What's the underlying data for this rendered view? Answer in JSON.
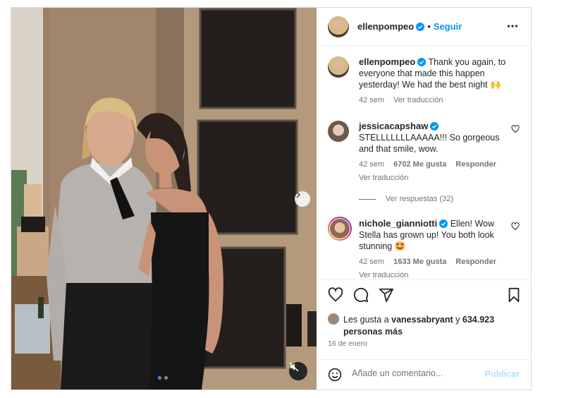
{
  "post": {
    "author": "ellenpompeo",
    "follow_label": "Seguir",
    "caption": "Thank you again, to everyone that made this happen yesterday! We had the best night 🙌",
    "caption_age": "42 sem",
    "see_translation": "Ver traducción"
  },
  "comments": [
    {
      "user": "jessicacapshaw",
      "text": "STELLLLLLLAAAAA!!! So gorgeous and that smile, wow.",
      "age": "42 sem",
      "likes": "6702 Me gusta",
      "reply": "Responder",
      "translate": "Ver traducción",
      "view_replies": "Ver respuestas (32)"
    },
    {
      "user": "nichole_gianniotti",
      "text": "Ellen! Wow Stella has grown up! You both look stunning 🤩",
      "age": "42 sem",
      "likes": "1633 Me gusta",
      "reply": "Responder",
      "translate": "Ver traducción"
    }
  ],
  "likes_line": {
    "prefix": "Les gusta a",
    "user": "vanessabryant",
    "joiner": "y",
    "count": "634.923",
    "suffix": "personas más"
  },
  "date": "16 de enero",
  "add_comment": {
    "placeholder": "Añade un comentario...",
    "publish_label": "Publicar"
  },
  "colors": {
    "accent": "#0095f6",
    "verified": "#0095f6",
    "muted": "#737373",
    "publish_disabled": "#b2dffc"
  },
  "icons": [
    "heart-icon",
    "comment-icon",
    "share-icon",
    "bookmark-icon",
    "more-icon",
    "verified-icon",
    "emoji-icon",
    "mute-icon",
    "chevron-right-icon"
  ],
  "carousel": {
    "total_slides": 2,
    "current_slide": 1
  }
}
